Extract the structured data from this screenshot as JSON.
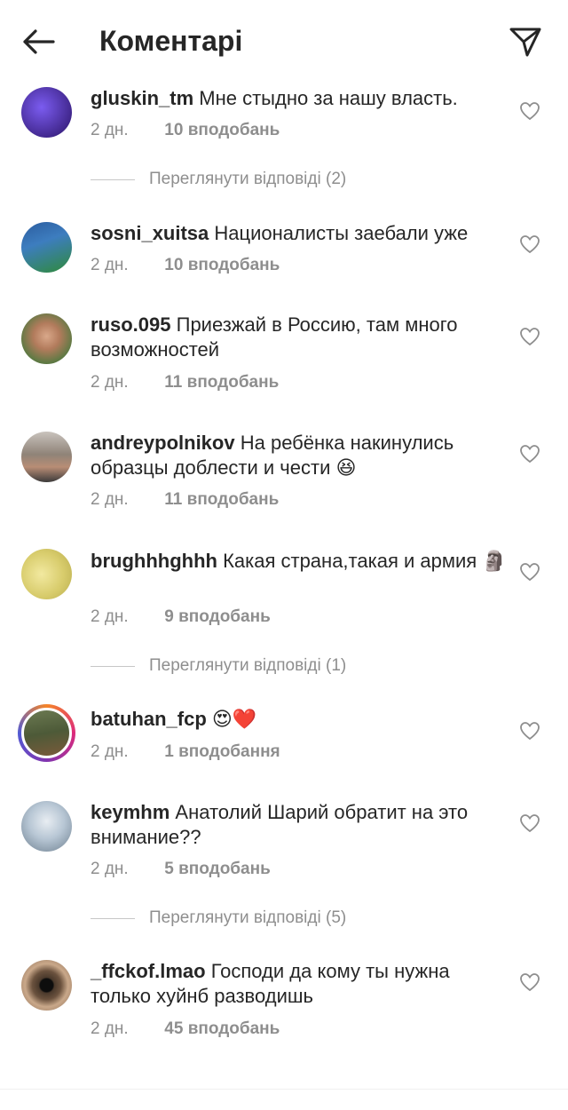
{
  "header": {
    "title": "Коментарі",
    "back_icon": "arrow-left-icon",
    "share_icon": "paper-plane-icon"
  },
  "comments": [
    {
      "username": "gluskin_tm",
      "text": "Мне стыдно за нашу власть.",
      "time": "2 дн.",
      "likes": "10 вподобань",
      "avatar_color": "#4b2aa8"
    },
    {
      "username": "sosni_xuitsa",
      "text": "Националисты заебали уже",
      "time": "2 дн.",
      "likes": "10 вподобань",
      "avatar_color": "#2f6fa8"
    },
    {
      "username": "ruso.095",
      "text": "Приезжай в Россию, там много возможностей",
      "time": "2 дн.",
      "likes": "11 вподобань",
      "avatar_color": "#6c8a4a"
    },
    {
      "username": "andreypolnikov",
      "text": "На ребёнка накинулись образцы доблести и чести",
      "emoji": "😆",
      "time": "2 дн.",
      "likes": "11 вподобань",
      "avatar_color": "#8a7c6e"
    },
    {
      "username": "brughhhghhh",
      "text": "Какая страна,такая и армия",
      "emoji": "🗿",
      "time": "2 дн.",
      "likes": "9 вподобань",
      "avatar_color": "#d9cf6a"
    },
    {
      "username": "batuhan_fcp",
      "text": "",
      "emoji": "😍❤️",
      "time": "2 дн.",
      "likes": "1 вподобання",
      "avatar_color": "#5a6b3c"
    },
    {
      "username": "keymhm",
      "text": "Анатолий Шарий обратит на это внимание??",
      "time": "2 дн.",
      "likes": "5 вподобань",
      "avatar_color": "#9fb4c8"
    },
    {
      "username": "_ffckof.lmao",
      "text": "Господи да кому ты нужна только хуйнб разводишь",
      "time": "2 дн.",
      "likes": "45 вподобань",
      "avatar_color": "#4a3a30"
    }
  ],
  "replies": [
    "Переглянути відповіді (2)",
    "Переглянути відповіді (1)",
    "Переглянути відповіді (5)"
  ]
}
